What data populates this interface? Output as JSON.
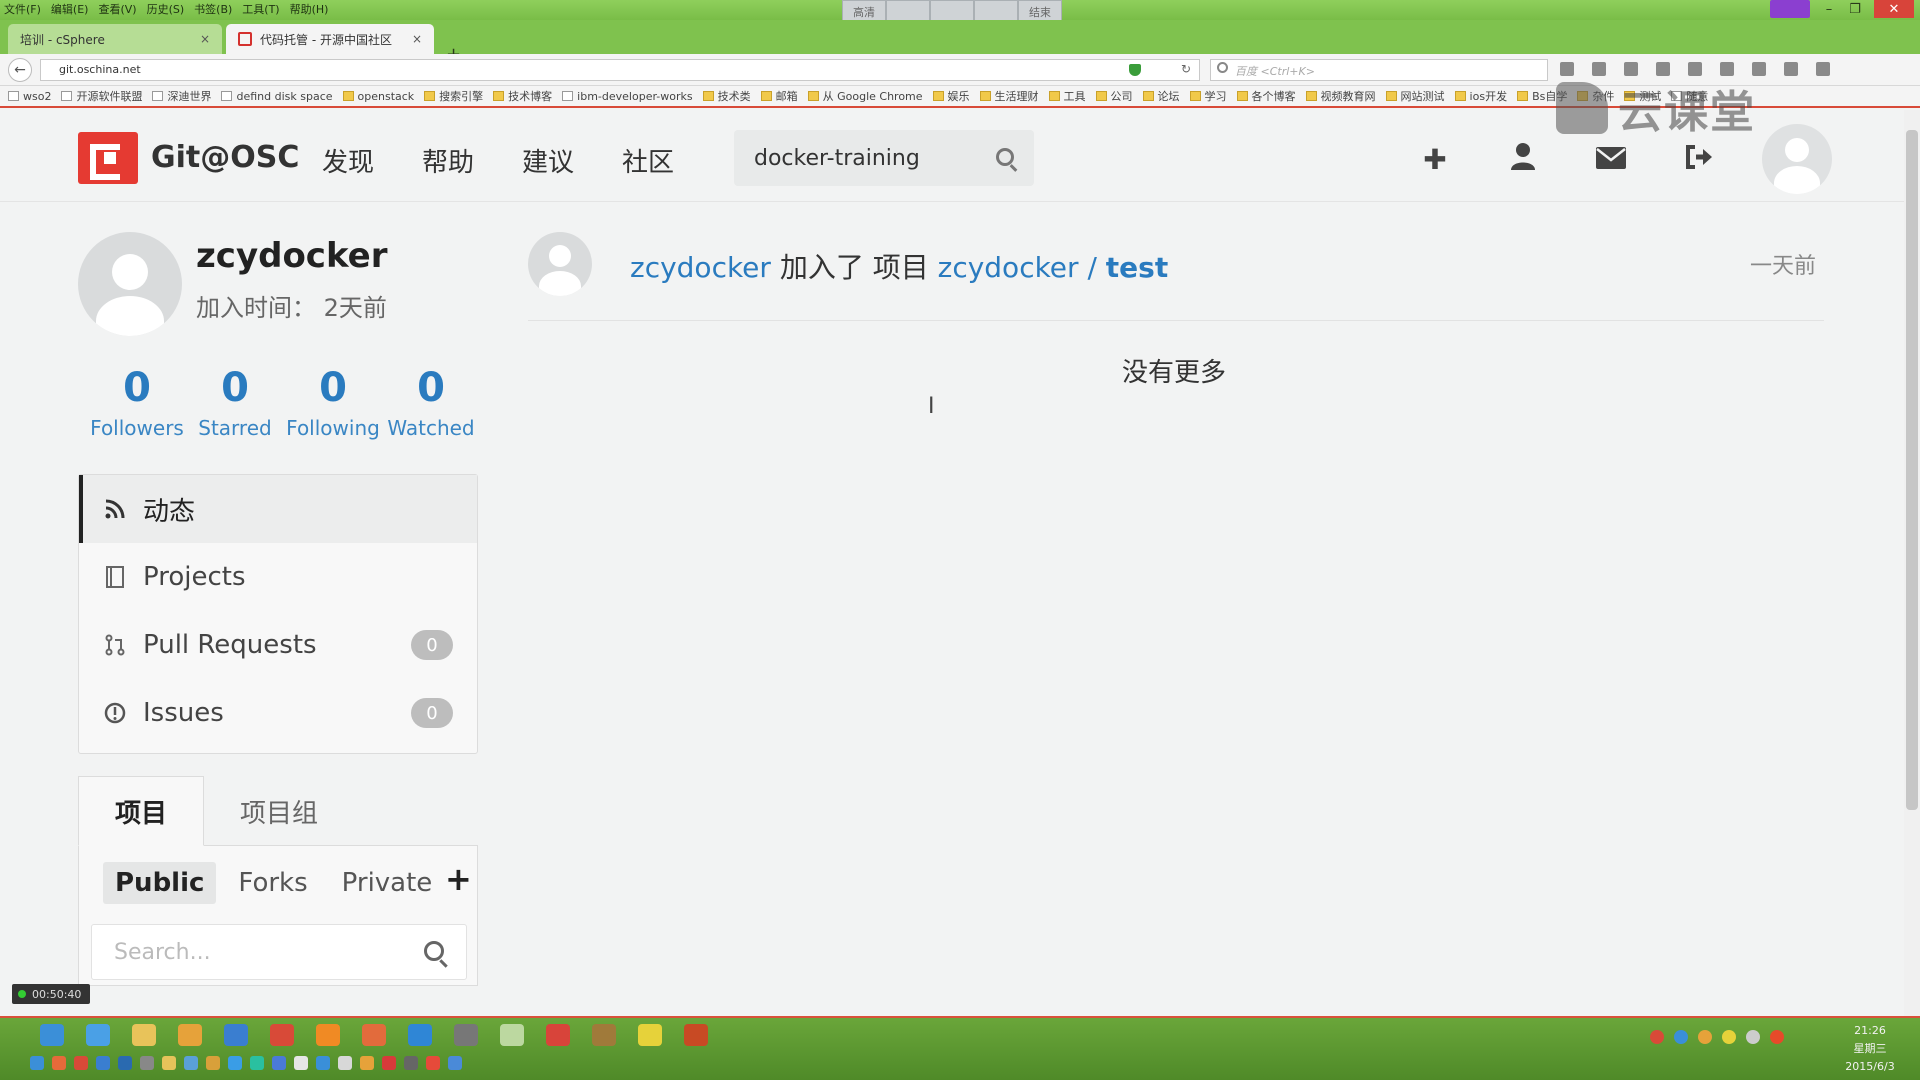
{
  "browser": {
    "menu": [
      "文件(F)",
      "编辑(E)",
      "查看(V)",
      "历史(S)",
      "书签(B)",
      "工具(T)",
      "帮助(H)"
    ],
    "screen_tools": [
      "高清",
      "",
      "",
      "",
      "结束"
    ],
    "tabs": [
      {
        "title": "培训 - cSphere",
        "close": "×"
      },
      {
        "title": "代码托管 - 开源中国社区",
        "close": "×"
      }
    ],
    "new_tab": "+",
    "url": "git.oschina.net",
    "search_placeholder": "百度 <Ctrl+K>",
    "bookmarks": [
      "wso2",
      "开源软件联盟",
      "深迪世界",
      "defind disk space",
      "openstack",
      "搜索引擎",
      "技术博客",
      "ibm-developer-works",
      "技术类",
      "邮箱",
      "从 Google Chrome",
      "娱乐",
      "生活理财",
      "工具",
      "公司",
      "论坛",
      "学习",
      "各个博客",
      "视频教育网",
      "网站测试",
      "ios开发",
      "Bs自学",
      "杂件",
      "测试",
      "随意"
    ],
    "watermark": "云课堂"
  },
  "header": {
    "brand": "Git@OSC",
    "nav": [
      "发现",
      "帮助",
      "建议",
      "社区"
    ],
    "search_value": "docker-training",
    "icons": [
      "plus-icon",
      "user-icon",
      "envelope-icon",
      "sign-out-icon"
    ]
  },
  "profile": {
    "username": "zcydocker",
    "join_time": "加入时间： 2天前",
    "stats": [
      {
        "value": "0",
        "label": "Followers"
      },
      {
        "value": "0",
        "label": "Starred"
      },
      {
        "value": "0",
        "label": "Following"
      },
      {
        "value": "0",
        "label": "Watched"
      }
    ]
  },
  "side_menu": [
    {
      "label": "动态",
      "icon": "rss-icon",
      "active": true
    },
    {
      "label": "Projects",
      "icon": "book-icon"
    },
    {
      "label": "Pull Requests",
      "icon": "pull-request-icon",
      "count": "0"
    },
    {
      "label": "Issues",
      "icon": "exclamation-circle-icon",
      "count": "0"
    }
  ],
  "projects": {
    "tabs": [
      "项目",
      "项目组"
    ],
    "filters": [
      "Public",
      "Forks",
      "Private"
    ],
    "add": "+",
    "search_placeholder": "Search..."
  },
  "feed": {
    "actor": "zcydocker",
    "action": " 加入了 项目 ",
    "project_owner": "zcydocker",
    "separator": " / ",
    "project_name": "test",
    "time": "一天前",
    "no_more": "没有更多"
  },
  "recording": {
    "timer": "00:50:40"
  },
  "taskbar": {
    "time": "21:26",
    "weekday": "星期三",
    "date": "2015/6/3"
  },
  "colors": {
    "link": "#2a7bbf",
    "brand_red": "#e53a32",
    "browser_green": "#7fc24e"
  }
}
